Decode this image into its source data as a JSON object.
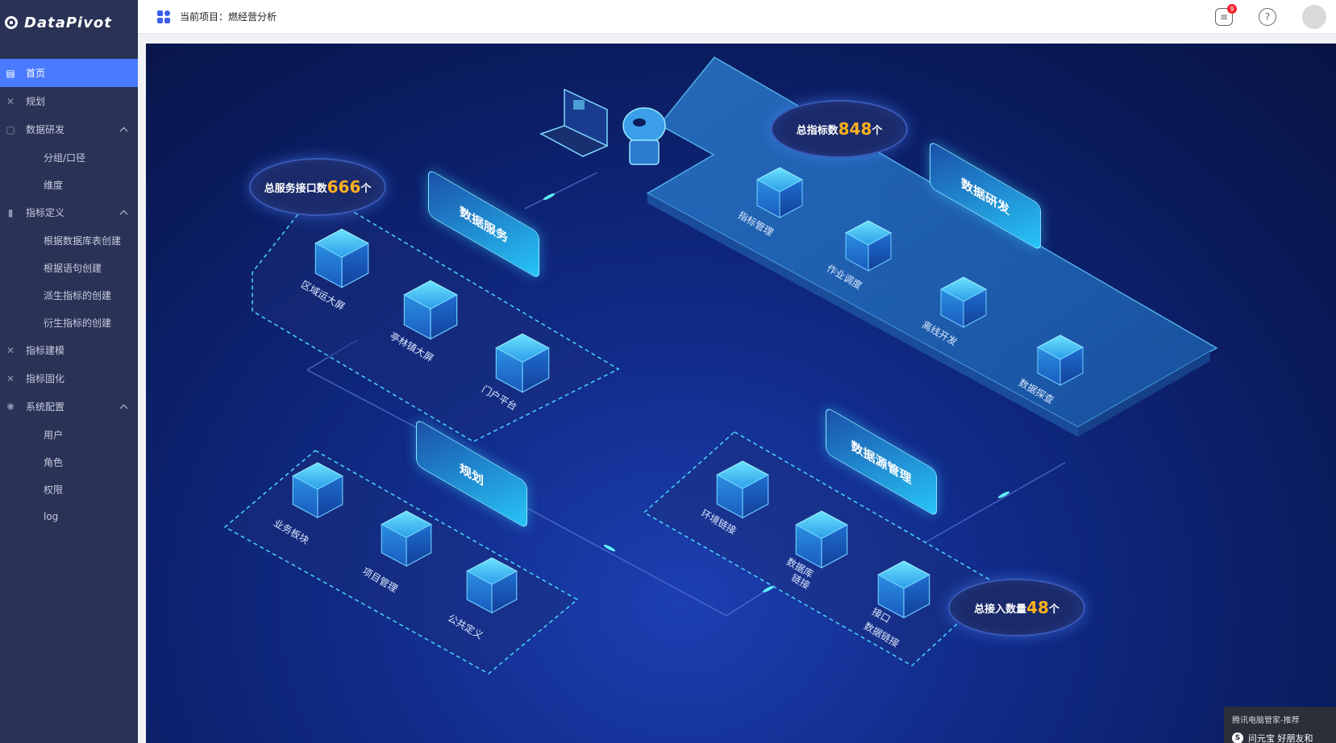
{
  "app": {
    "logo_text": "DataPivot"
  },
  "header": {
    "project_label": "当前项目：燃经营分析",
    "badge_count": "9"
  },
  "sidebar": {
    "items": [
      {
        "label": "首页",
        "level": "top",
        "active": true,
        "icon": "home-icon"
      },
      {
        "label": "规划",
        "level": "top",
        "icon": "tools-icon"
      },
      {
        "label": "数据研发",
        "level": "top",
        "expanded": true,
        "icon": "book-icon"
      },
      {
        "label": "分组/口径",
        "level": "sub"
      },
      {
        "label": "维度",
        "level": "sub"
      },
      {
        "label": "指标定义",
        "level": "top",
        "expanded": true,
        "icon": "bar-chart-icon"
      },
      {
        "label": "根据数据库表创建",
        "level": "sub"
      },
      {
        "label": "根据语句创建",
        "level": "sub"
      },
      {
        "label": "派生指标的创建",
        "level": "sub"
      },
      {
        "label": "衍生指标的创建",
        "level": "sub"
      },
      {
        "label": "指标建模",
        "level": "top",
        "icon": "tools-icon"
      },
      {
        "label": "指标固化",
        "level": "top",
        "icon": "tools-icon"
      },
      {
        "label": "系统配置",
        "level": "top",
        "expanded": true,
        "icon": "gear-icon"
      },
      {
        "label": "用户",
        "level": "sub"
      },
      {
        "label": "角色",
        "level": "sub"
      },
      {
        "label": "权限",
        "level": "sub"
      },
      {
        "label": "log",
        "level": "sub"
      }
    ]
  },
  "diagram": {
    "stats": [
      {
        "label": "总服务接口数",
        "value": "666",
        "unit": "个"
      },
      {
        "label": "总指标数",
        "value": "848",
        "unit": "个"
      },
      {
        "label": "总接入数量",
        "value": "48",
        "unit": "个"
      }
    ],
    "sections": {
      "service": "数据服务",
      "research": "数据研发",
      "planning": "规划",
      "datasource": "数据源管理"
    },
    "service_items": [
      "区域运大屏",
      "亭林镇大屏",
      "门户平台"
    ],
    "research_items": [
      "指标管理",
      "作业调度",
      "离线开发",
      "数据探查"
    ],
    "planning_items": [
      "业务板块",
      "项目管理",
      "公共定义"
    ],
    "datasource_items": [
      "环境链接",
      "数据库",
      "链接",
      "接口",
      "数据链接"
    ]
  },
  "popup": {
    "title": "腾讯电脑管家-推荐",
    "logo": "S",
    "text": "问元宝  好朋友和",
    "text_full": "问元宝   好朋友和"
  }
}
